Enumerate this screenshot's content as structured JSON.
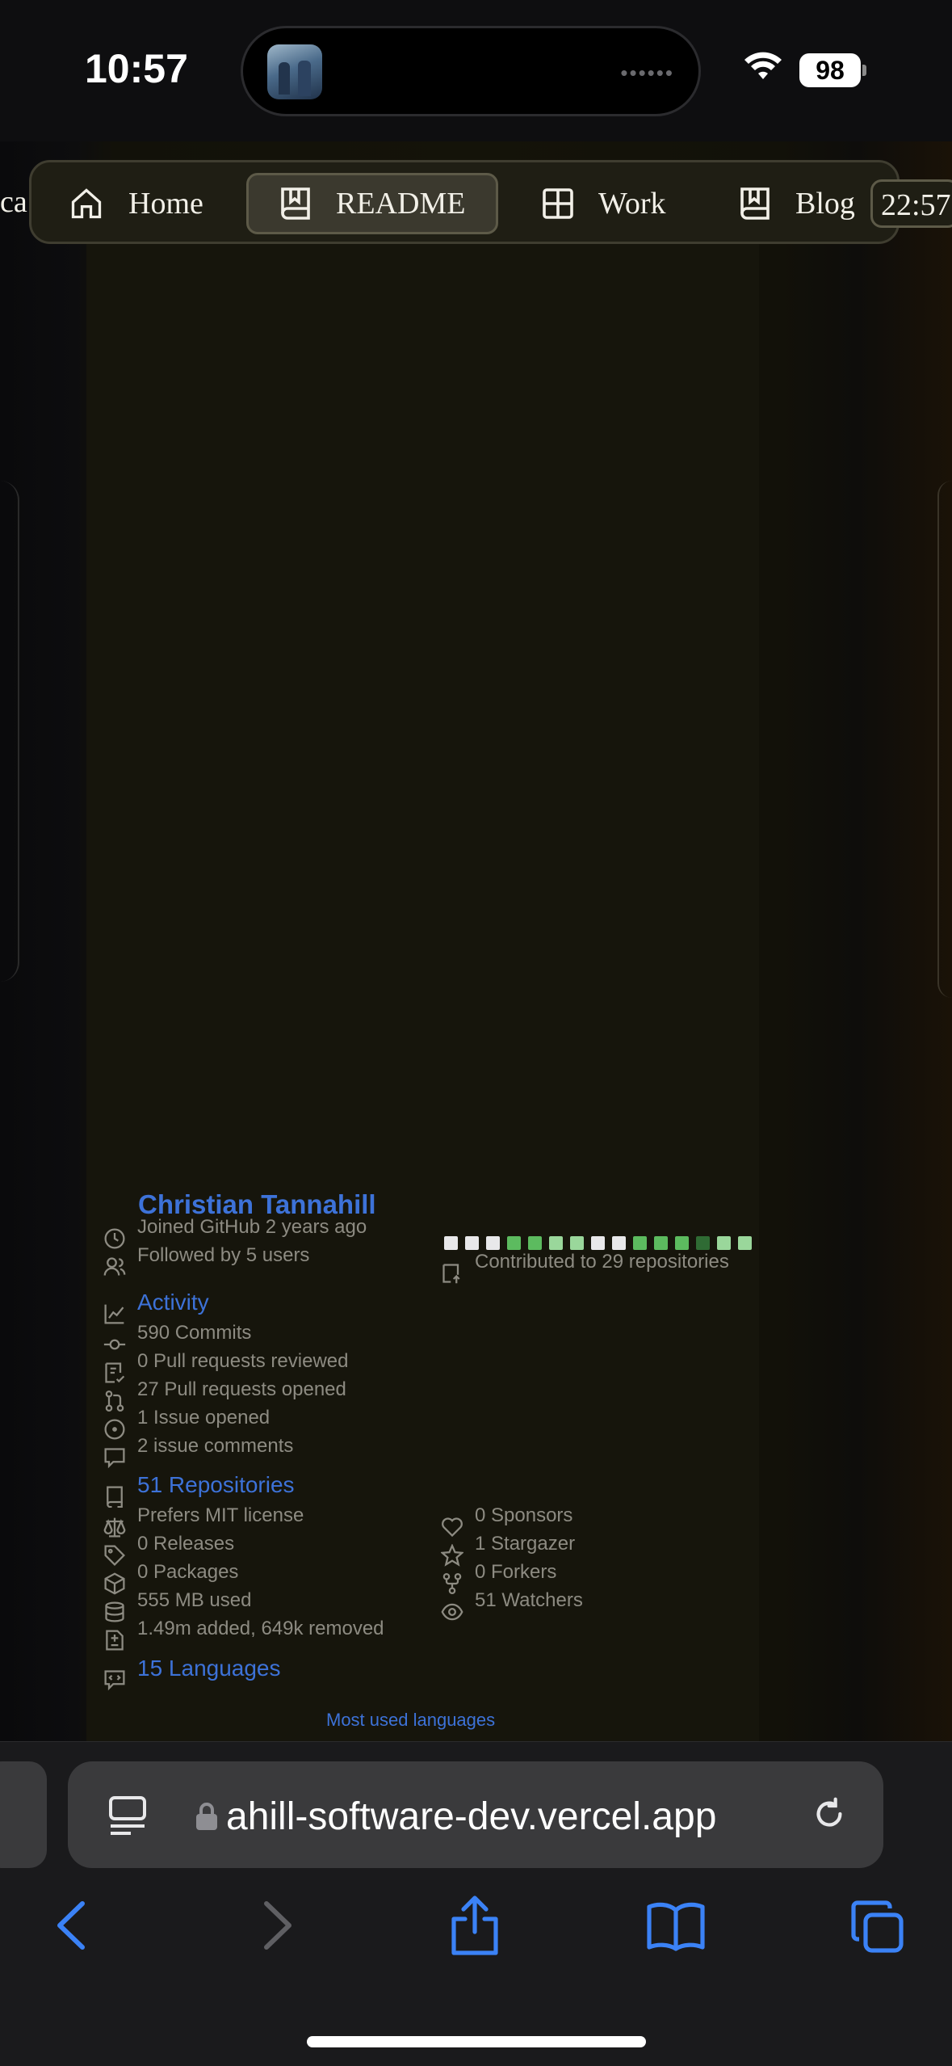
{
  "status_bar": {
    "time": "10:57",
    "battery": "98"
  },
  "nav": {
    "cut_label": "ca",
    "items": [
      {
        "label": "Home",
        "icon": "home-icon"
      },
      {
        "label": "README",
        "icon": "book-icon",
        "active": true
      },
      {
        "label": "Work",
        "icon": "grid-icon"
      },
      {
        "label": "Blog",
        "icon": "book-icon"
      }
    ],
    "clock": "22:57"
  },
  "github": {
    "name": "Christian Tannahill",
    "joined": "Joined GitHub 2 years ago",
    "followers": "Followed by 5 users",
    "contributed": "Contributed to 29 repositories",
    "contribution_levels": [
      0,
      0,
      0,
      2,
      2,
      1,
      1,
      0,
      0,
      2,
      2,
      2,
      3,
      1,
      1
    ],
    "activity": {
      "title": "Activity",
      "items": [
        {
          "icon": "commit-icon",
          "text": "590 Commits"
        },
        {
          "icon": "review-icon",
          "text": "0 Pull requests reviewed"
        },
        {
          "icon": "pull-request-icon",
          "text": "27 Pull requests opened"
        },
        {
          "icon": "issue-icon",
          "text": "1 Issue opened"
        },
        {
          "icon": "comment-icon",
          "text": "2 issue comments"
        }
      ]
    },
    "repositories": {
      "title": "51 Repositories",
      "left": [
        {
          "icon": "law-icon",
          "text": "Prefers MIT license"
        },
        {
          "icon": "tag-icon",
          "text": "0 Releases"
        },
        {
          "icon": "package-icon",
          "text": "0 Packages"
        },
        {
          "icon": "database-icon",
          "text": "555 MB used"
        },
        {
          "icon": "diff-icon",
          "text": "1.49m added, 649k removed"
        }
      ],
      "right": [
        {
          "icon": "heart-icon",
          "text": "0 Sponsors"
        },
        {
          "icon": "star-icon",
          "text": "1 Stargazer"
        },
        {
          "icon": "fork-icon",
          "text": "0 Forkers"
        },
        {
          "icon": "eye-icon",
          "text": "51 Watchers"
        }
      ]
    },
    "languages": {
      "title": "15 Languages",
      "link": "Most used languages"
    }
  },
  "browser": {
    "url": "ahill-software-dev.vercel.app",
    "colors": {
      "accent": "#3d72d8",
      "toolbar_blue": "#3b82f6"
    }
  }
}
